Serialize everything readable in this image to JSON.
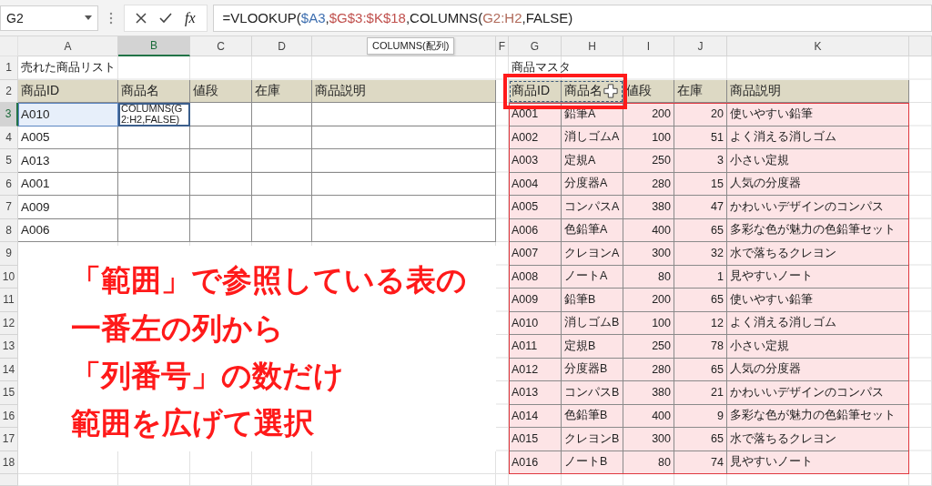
{
  "name_box": "G2",
  "fx_label": "fx",
  "formula": [
    {
      "text": "=VLOOKUP("
    },
    {
      "text": "$A3",
      "color": "#3e6fb0"
    },
    {
      "text": ","
    },
    {
      "text": "$G$3:$K$18",
      "color": "#c0504d"
    },
    {
      "text": ",COLUMNS("
    },
    {
      "text": "G2:H2",
      "color": "#b06a5a"
    },
    {
      "text": ",FALSE)"
    }
  ],
  "tooltip": "COLUMNS(配列)",
  "columns": [
    {
      "label": "A",
      "selected": false
    },
    {
      "label": "B",
      "selected": true
    },
    {
      "label": "C",
      "selected": false
    },
    {
      "label": "D",
      "selected": false
    },
    {
      "selected": false
    },
    {
      "label": "F",
      "selected": false
    },
    {
      "label": "G",
      "selected": false
    },
    {
      "label": "H",
      "selected": false
    },
    {
      "label": "I",
      "selected": false
    },
    {
      "label": "J",
      "selected": false
    },
    {
      "label": "K",
      "selected": false
    }
  ],
  "row_numbers": [
    {
      "label": "1",
      "selected": false
    },
    {
      "label": "2",
      "selected": false
    },
    {
      "label": "3",
      "selected": true
    },
    {
      "label": "4",
      "selected": false
    },
    {
      "label": "5",
      "selected": false
    },
    {
      "label": "6",
      "selected": false
    },
    {
      "label": "7",
      "selected": false
    },
    {
      "label": "8",
      "selected": false
    },
    {
      "label": "9",
      "selected": false
    },
    {
      "label": "10",
      "selected": false
    },
    {
      "label": "11",
      "selected": false
    },
    {
      "label": "12",
      "selected": false
    },
    {
      "label": "13",
      "selected": false
    },
    {
      "label": "14",
      "selected": false
    },
    {
      "label": "15",
      "selected": false
    },
    {
      "label": "16",
      "selected": false
    },
    {
      "label": "17",
      "selected": false
    },
    {
      "label": "18",
      "selected": false
    }
  ],
  "sold_list": {
    "title": "売れた商品リスト",
    "headers": [
      "商品ID",
      "商品名",
      "値段",
      "在庫",
      "商品説明"
    ],
    "editing_text": "COLUMNS(G2:H2,FALSE)",
    "rows": [
      {
        "id": "A010",
        "highlighted": true
      },
      {
        "id": "A005",
        "highlighted": false
      },
      {
        "id": "A013",
        "highlighted": false
      },
      {
        "id": "A001",
        "highlighted": false
      },
      {
        "id": "A009",
        "highlighted": false
      },
      {
        "id": "A006",
        "highlighted": false
      }
    ]
  },
  "master": {
    "title": "商品マスタ",
    "headers": [
      "商品ID",
      "商品名",
      "値段",
      "在庫",
      "商品説明"
    ],
    "rows": [
      [
        "A001",
        "鉛筆A",
        "200",
        "20",
        "使いやすい鉛筆"
      ],
      [
        "A002",
        "消しゴムA",
        "100",
        "51",
        "よく消える消しゴム"
      ],
      [
        "A003",
        "定規A",
        "250",
        "3",
        "小さい定規"
      ],
      [
        "A004",
        "分度器A",
        "280",
        "15",
        "人気の分度器"
      ],
      [
        "A005",
        "コンパスA",
        "380",
        "47",
        "かわいいデザインのコンパス"
      ],
      [
        "A006",
        "色鉛筆A",
        "400",
        "65",
        "多彩な色が魅力の色鉛筆セット"
      ],
      [
        "A007",
        "クレヨンA",
        "300",
        "32",
        "水で落ちるクレヨン"
      ],
      [
        "A008",
        "ノートA",
        "80",
        "1",
        "見やすいノート"
      ],
      [
        "A009",
        "鉛筆B",
        "200",
        "65",
        "使いやすい鉛筆"
      ],
      [
        "A010",
        "消しゴムB",
        "100",
        "12",
        "よく消える消しゴム"
      ],
      [
        "A011",
        "定規B",
        "250",
        "78",
        "小さい定規"
      ],
      [
        "A012",
        "分度器B",
        "280",
        "65",
        "人気の分度器"
      ],
      [
        "A013",
        "コンパスB",
        "380",
        "21",
        "かわいいデザインのコンパス"
      ],
      [
        "A014",
        "色鉛筆B",
        "400",
        "9",
        "多彩な色が魅力の色鉛筆セット"
      ],
      [
        "A015",
        "クレヨンB",
        "300",
        "65",
        "水で落ちるクレヨン"
      ],
      [
        "A016",
        "ノートB",
        "80",
        "74",
        "見やすいノート"
      ]
    ]
  },
  "callout": [
    "「範囲」で参照している表の",
    "一番左の列から",
    "「列番号」の数だけ",
    "範囲を広げて選択"
  ]
}
